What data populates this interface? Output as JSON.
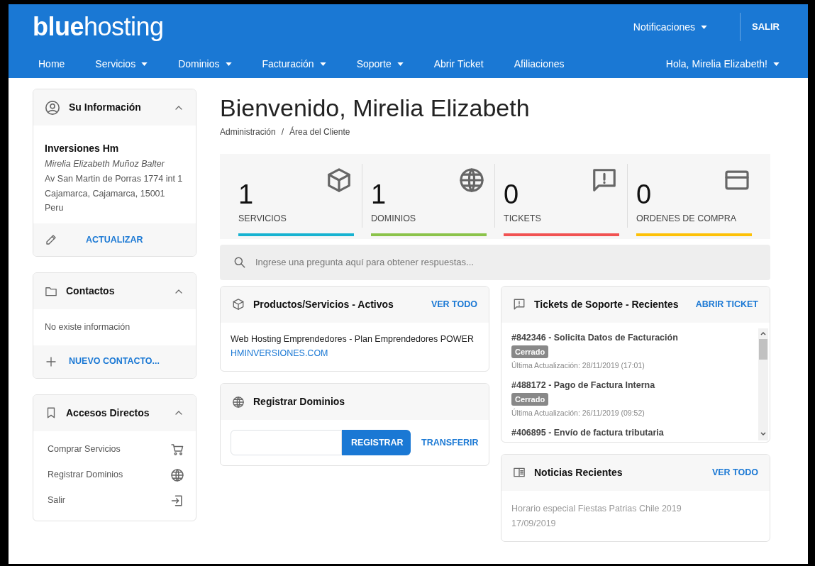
{
  "header": {
    "logo": "**blue**hosting",
    "notifications": {
      "label": "Notificaciones",
      "dropdown": true
    },
    "logout": "SALIR"
  },
  "nav": {
    "items": [
      {
        "label": "Home",
        "dropdown": false
      },
      {
        "label": "Servicios",
        "dropdown": true
      },
      {
        "label": "Dominios",
        "dropdown": true
      },
      {
        "label": "Facturación",
        "dropdown": true
      },
      {
        "label": "Soporte",
        "dropdown": true
      },
      {
        "label": "Abrir Ticket",
        "dropdown": false
      },
      {
        "label": "Afiliaciones",
        "dropdown": false
      }
    ],
    "user": {
      "label": "Hola, Mirelia Elizabeth!",
      "dropdown": true
    }
  },
  "sidebar": {
    "info": {
      "title": "Su Información",
      "expanded": true,
      "company": "Inversiones Hm",
      "name": "Mirelia Elizabeth Muñoz Balter",
      "lines": [
        "Av San Martin de Porras 1774 int 1",
        "Cajamarca, Cajamarca, 15001",
        "Peru"
      ],
      "action": "ACTUALIZAR"
    },
    "contacts": {
      "title": "Contactos",
      "expanded": true,
      "empty_text": "No existe información",
      "action": "NUEVO CONTACTO..."
    },
    "shortcuts": {
      "title": "Accesos Directos",
      "expanded": true,
      "items": [
        "Comprar Servicios",
        "Registrar Dominios",
        "Salir"
      ]
    }
  },
  "page": {
    "title": "Bienvenido, Mirelia Elizabeth",
    "breadcrumb": [
      "Administración",
      "Área del Cliente"
    ],
    "separator": "/"
  },
  "stats": [
    {
      "value": "1",
      "label": "SERVICIOS",
      "color": "#17b3d1"
    },
    {
      "value": "1",
      "label": "DOMINIOS",
      "color": "#8bc34a"
    },
    {
      "value": "0",
      "label": "TICKETS",
      "color": "#f15252"
    },
    {
      "value": "0",
      "label": "ORDENES DE COMPRA",
      "color": "#fdc107"
    }
  ],
  "search": {
    "placeholder": "Ingrese una pregunta aquí para obtener respuestas..."
  },
  "products": {
    "title": "Productos/Servicios - Activos",
    "action": "VER TODO",
    "items": [
      {
        "name": "Web Hosting Emprendedores - Plan Emprendedores POWER",
        "domain": "HMINVERSIONES.COM"
      }
    ]
  },
  "domains": {
    "title": "Registrar Dominios",
    "register": "REGISTRAR",
    "transfer": "TRANSFERIR"
  },
  "tickets": {
    "title": "Tickets de Soporte - Recientes",
    "action": "ABRIR TICKET",
    "items": [
      {
        "subject": "#842346 - Solicita Datos de Facturación",
        "status": "Cerrado",
        "updated": "Última Actualización: 28/11/2019 (17:01)"
      },
      {
        "subject": "#488172 - Pago de Factura Interna",
        "status": "Cerrado",
        "updated": "Última Actualización: 26/11/2019 (09:52)"
      },
      {
        "subject": "#406895 - Envío de factura tributaria"
      }
    ]
  },
  "news": {
    "title": "Noticias Recientes",
    "action": "VER TODO",
    "items": [
      {
        "headline": "Horario especial Fiestas Patrias Chile 2019",
        "date": "17/09/2019"
      }
    ]
  }
}
